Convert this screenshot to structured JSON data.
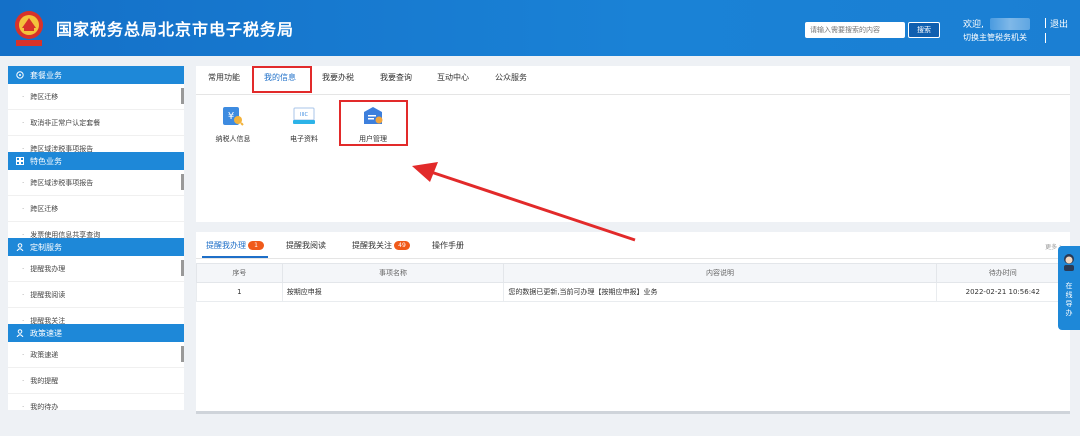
{
  "header": {
    "title": "国家税务总局北京市电子税务局",
    "emblem_text": "国家税务",
    "search_placeholder": "请输入需要搜索的内容",
    "search_button": "搜索",
    "welcome": "欢迎,",
    "switch_label": "切换主管税务机关",
    "logout": "退出"
  },
  "sidebar": {
    "sections": [
      {
        "title": "套餐业务",
        "items": [
          "跨区迁移",
          "取消非正常户认定套餐",
          "跨区域涉税事项报告"
        ]
      },
      {
        "title": "特色业务",
        "items": [
          "跨区域涉税事项报告",
          "跨区迁移",
          "发票使用信息共享查询"
        ]
      },
      {
        "title": "定制服务",
        "items": [
          "提醒我办理",
          "提醒我阅读",
          "提醒我关注"
        ]
      },
      {
        "title": "政策速递",
        "items": [
          "政策速递",
          "我的提醒",
          "我的待办"
        ]
      }
    ]
  },
  "top_tabs": [
    "常用功能",
    "我的信息",
    "我要办税",
    "我要查询",
    "互动中心",
    "公众服务"
  ],
  "apps": [
    {
      "label": "纳税人信息",
      "icon": "taxpayer-info-icon"
    },
    {
      "label": "电子资料",
      "icon": "e-document-icon"
    },
    {
      "label": "用户管理",
      "icon": "user-management-icon"
    }
  ],
  "bottom_tabs": [
    {
      "label": "提醒我办理",
      "badge": "1"
    },
    {
      "label": "提醒我阅读",
      "badge": ""
    },
    {
      "label": "提醒我关注",
      "badge": "49"
    },
    {
      "label": "操作手册",
      "badge": ""
    }
  ],
  "more": "更多 >",
  "table": {
    "headers": [
      "序号",
      "事项名称",
      "内容说明",
      "待办时间"
    ],
    "rows": [
      [
        "1",
        "按期应申报",
        "您的数据已更新,当前可办理【按期应申报】业务",
        "2022-02-21 10:56:42"
      ]
    ]
  },
  "side_float": "在线导办",
  "colors": {
    "primary": "#1e88d8",
    "header": "#1470c8",
    "highlight": "#e22a2a",
    "badge": "#f05a1a"
  }
}
